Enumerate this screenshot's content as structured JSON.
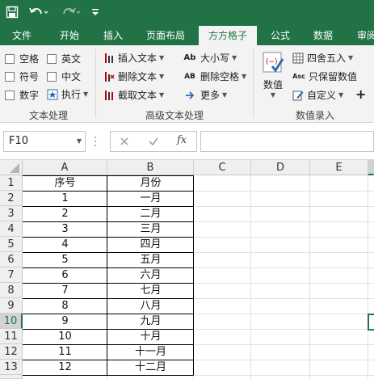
{
  "quick_access": {
    "save_icon": "save-icon",
    "undo_icon": "undo-icon",
    "redo_icon": "redo-icon",
    "customize_icon": "customize-icon"
  },
  "tabs": [
    {
      "label": "文件",
      "active": false
    },
    {
      "label": "开始",
      "active": false
    },
    {
      "label": "插入",
      "active": false
    },
    {
      "label": "页面布局",
      "active": false
    },
    {
      "label": "方方格子",
      "active": true
    },
    {
      "label": "公式",
      "active": false
    },
    {
      "label": "数据",
      "active": false
    },
    {
      "label": "审阅",
      "active": false
    }
  ],
  "ribbon": {
    "text_group": {
      "label": "文本处理",
      "checkboxes": [
        "空格",
        "英文",
        "符号",
        "中文",
        "数字"
      ],
      "execute_label": "执行"
    },
    "advanced_group": {
      "label": "高级文本处理",
      "insert_text": "插入文本",
      "delete_text": "删除文本",
      "extract_text": "截取文本",
      "case": "大小写",
      "delete_space": "删除空格",
      "more": "更多",
      "case_icon_text": "Ab",
      "delete_space_icon_text": "AB"
    },
    "number_group": {
      "label": "数值录入",
      "value_label": "数值",
      "round": "四舍五入",
      "keep_value": "只保留数值",
      "custom": "自定义",
      "keep_value_icon_text": "Asc"
    }
  },
  "formula_bar": {
    "name_box": "F10",
    "fx_label": "fx",
    "formula": ""
  },
  "sheet": {
    "columns": [
      "A",
      "B",
      "C",
      "D",
      "E"
    ],
    "row_numbers": [
      "1",
      "2",
      "3",
      "4",
      "5",
      "6",
      "7",
      "8",
      "9",
      "10",
      "11",
      "12",
      "13"
    ],
    "selected_row": "10",
    "rows": [
      [
        "序号",
        "月份"
      ],
      [
        "1",
        "一月"
      ],
      [
        "2",
        "二月"
      ],
      [
        "3",
        "三月"
      ],
      [
        "4",
        "四月"
      ],
      [
        "5",
        "五月"
      ],
      [
        "6",
        "六月"
      ],
      [
        "7",
        "七月"
      ],
      [
        "8",
        "八月"
      ],
      [
        "9",
        "九月"
      ],
      [
        "10",
        "十月"
      ],
      [
        "11",
        "十一月"
      ],
      [
        "12",
        "十二月"
      ]
    ]
  },
  "colors": {
    "ribbon_green": "#217346",
    "ribbon_bg": "#f3f3f3"
  }
}
